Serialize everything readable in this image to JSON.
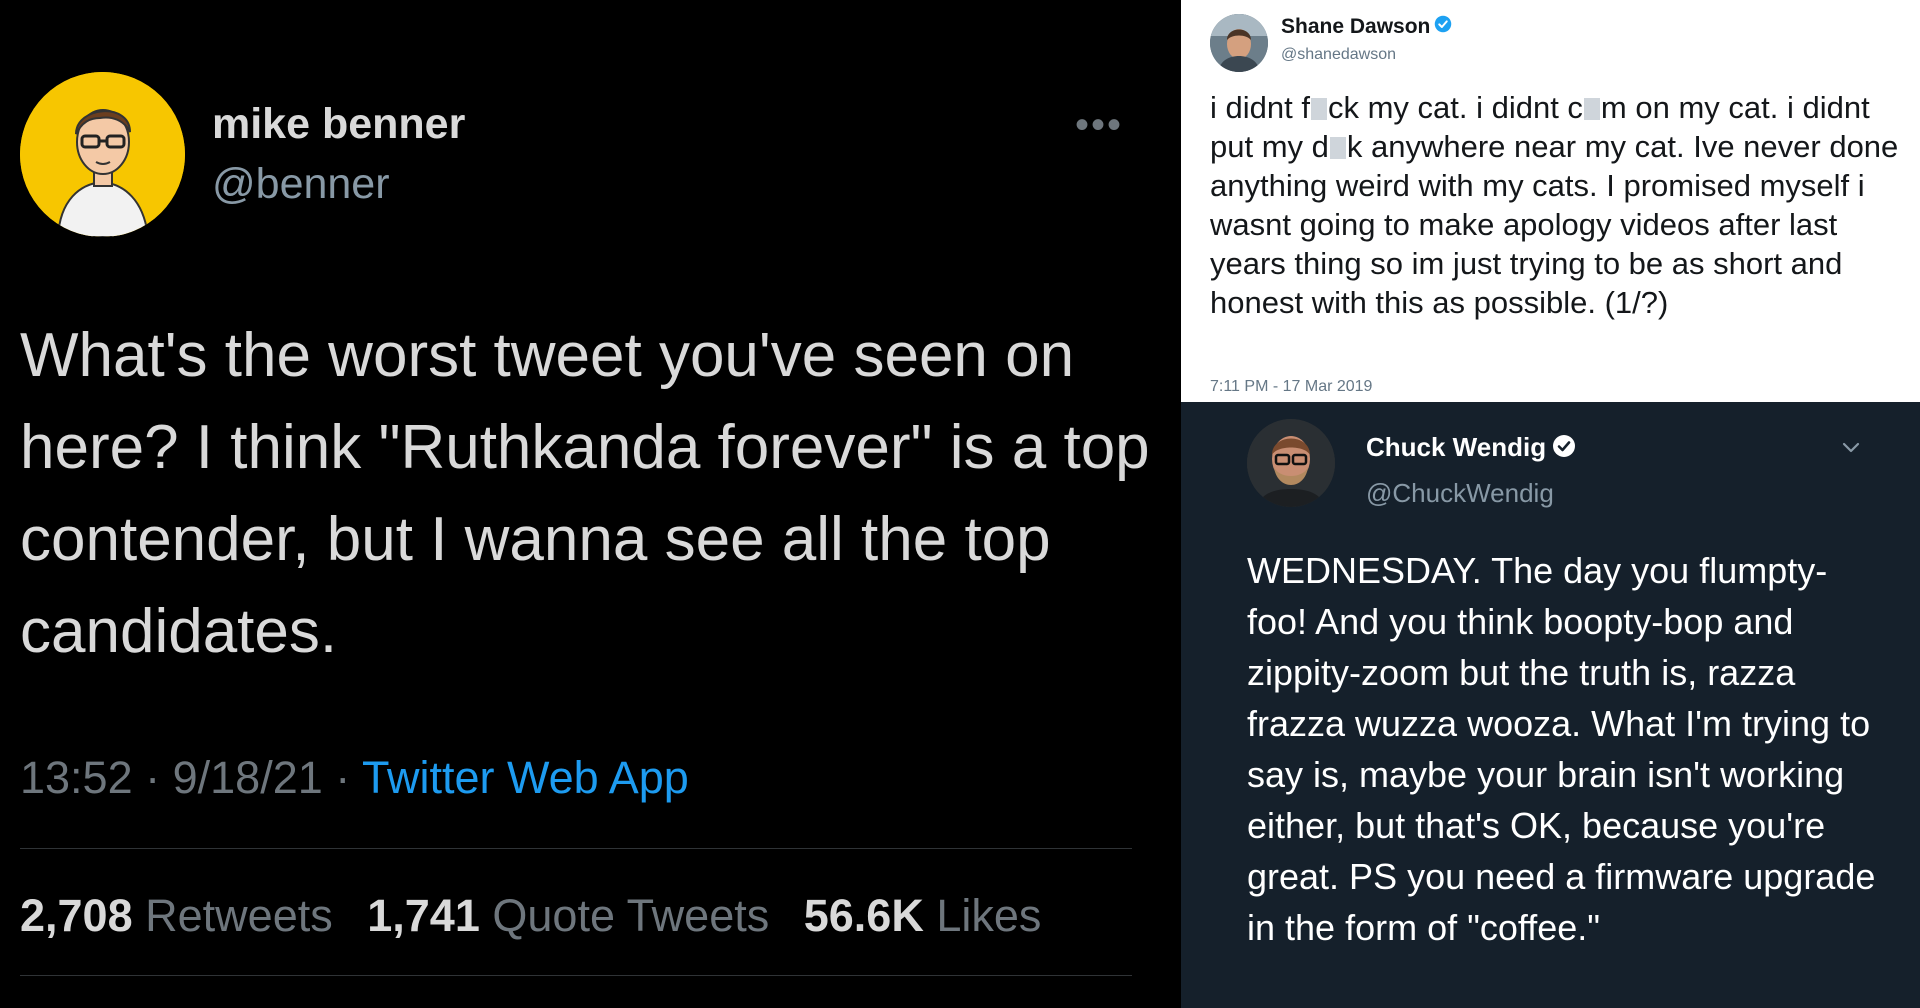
{
  "left_tweet": {
    "name": "mike benner",
    "handle": "@benner",
    "more_icon": "ellipsis-icon",
    "text": "What's the worst tweet you've seen on here? I think \"Ruthkanda forever\" is a top contender, but I wanna see all the top candidates.",
    "time": "13:52",
    "date": "9/18/21",
    "separator": " · ",
    "source": "Twitter Web App",
    "stats": {
      "retweets_count": "2,708",
      "retweets_label": "Retweets",
      "quotes_count": "1,741",
      "quotes_label": "Quote Tweets",
      "likes_count": "56.6K",
      "likes_label": "Likes"
    },
    "colors": {
      "background": "#000000",
      "link": "#1d9bf0",
      "text": "#d9d9d9",
      "muted": "#6e767d",
      "avatar_bg": "#f7c600"
    }
  },
  "top_right_tweet": {
    "name": "Shane Dawson",
    "handle": "@shanedawson",
    "text_parts": [
      "i didnt f",
      "ck my cat. i didnt c",
      "m on my cat. i didnt put my d",
      "k anywhere near my cat. Ive never done anything weird with my cats. I promised myself i wasnt going to make apology videos after last years thing so im just trying to be as short and honest with this as possible. (1/?)"
    ],
    "timestamp": "7:11 PM - 17 Mar 2019",
    "colors": {
      "background": "#ffffff",
      "verified": "#1da1f2"
    }
  },
  "bottom_right_tweet": {
    "name": "Chuck Wendig",
    "handle": "@ChuckWendig",
    "text": "WEDNESDAY. The day you flumpty-foo! And you think boopty-bop and zippity-zoom but the truth is, razza frazza wuzza wooza. What I'm trying to say is, maybe your brain isn't working either, but that's OK, because you're great. PS you need a firmware upgrade in the form of \"coffee.\"",
    "colors": {
      "background": "#15202b"
    }
  }
}
